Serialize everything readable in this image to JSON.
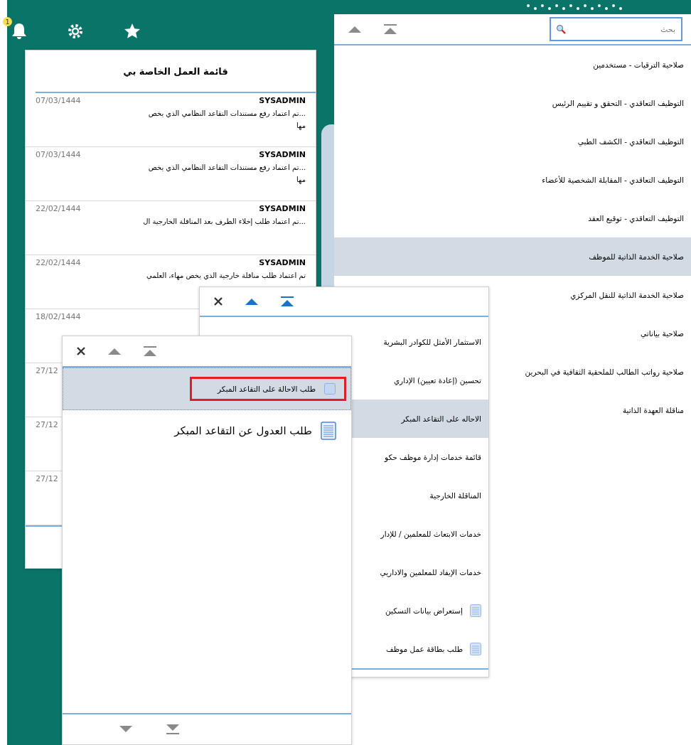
{
  "toolbar": {
    "notification_count": "1"
  },
  "worklist": {
    "title": "قائمة العمل الخاصة بي",
    "items": [
      {
        "sender": "SYSADMIN",
        "date": "07/03/1444",
        "message": "...تم اعتماد رفع مستندات التقاعد النظامي الذي يخص مها"
      },
      {
        "sender": "SYSADMIN",
        "date": "07/03/1444",
        "message": "...تم اعتماد رفع مستندات التقاعد النظامي الذي يخص مها"
      },
      {
        "sender": "SYSADMIN",
        "date": "22/02/1444",
        "message": "...تم اعتماد طلب إخلاء الطرف بعد المناقلة الخارجية ال"
      },
      {
        "sender": "SYSADMIN",
        "date": "22/02/1444",
        "message": "تم اعتماد طلب مناقلة خارجية الذي يخص مهاء، العلمي"
      },
      {
        "date": "18/02/1444"
      },
      {
        "date": "27/12"
      },
      {
        "date": "27/12"
      },
      {
        "date": "27/12"
      }
    ]
  },
  "main_menu": {
    "controls": [
      {
        "kind": "up",
        "disabled": true
      },
      {
        "kind": "top",
        "disabled": true
      }
    ],
    "search": {
      "placeholder": "بحث"
    },
    "items": [
      {
        "label": "صلاحية الترقيات - مستخدمين",
        "selected": false
      },
      {
        "label": "التوظيف التعاقدي - التحقق و تقييم الرئيس",
        "selected": false
      },
      {
        "label": "التوظيف التعاقدي - الكشف الطبي",
        "selected": false
      },
      {
        "label": "التوظيف التعاقدي - المقابلة الشخصية للأعضاء",
        "selected": false
      },
      {
        "label": "التوظيف التعاقدي - توقيع العقد",
        "selected": false
      },
      {
        "label": "صلاحية الخدمة الذاتية للموظف",
        "selected": true
      },
      {
        "label": "صلاحية الخدمة الذاتية للنقل المركزي",
        "selected": false
      },
      {
        "label": "صلاحية بياناتي",
        "selected": false
      },
      {
        "label": "صلاحية رواتب الطالب للملحقية الثقافية في البحرين",
        "selected": false
      },
      {
        "label": "مناقلة العهدة الذاتية",
        "selected": false
      }
    ]
  },
  "submenu": {
    "controls": [
      {
        "kind": "close"
      },
      {
        "kind": "up",
        "disabled": false
      },
      {
        "kind": "top",
        "disabled": false
      }
    ],
    "items": [
      {
        "label": "الاستثمار الأمثل للكوادر البشرية",
        "selected": false,
        "kind": "folder"
      },
      {
        "label": "تحسين (إعادة تعيين) الإداري",
        "selected": false,
        "kind": "folder"
      },
      {
        "label": "الاحاله على التقاعد المبكر",
        "selected": true,
        "kind": "folder"
      },
      {
        "label": "قائمة خدمات إدارة موظف حكو",
        "selected": false,
        "kind": "folder"
      },
      {
        "label": "المناقلة الخارجية",
        "selected": false,
        "kind": "folder"
      },
      {
        "label": "خدمات الابتعاث للمعلمين / للإدار",
        "selected": false,
        "kind": "folder"
      },
      {
        "label": "خدمات الإيفاد للمعلمين والاداريي",
        "selected": false,
        "kind": "folder"
      },
      {
        "label": "إستعراض بيانات التسكين",
        "selected": false,
        "kind": "document"
      },
      {
        "label": "طلب بطاقة عمل موظف",
        "selected": false,
        "kind": "document"
      }
    ]
  },
  "task_menu": {
    "controls": [
      {
        "kind": "close"
      },
      {
        "kind": "up",
        "disabled": true
      },
      {
        "kind": "top",
        "disabled": true
      }
    ],
    "footer_controls": [
      {
        "kind": "down",
        "disabled": true
      },
      {
        "kind": "bottom",
        "disabled": true
      }
    ],
    "items": [
      {
        "label": "طلب الاحالة على التقاعد المبكر",
        "selected": true,
        "outlined": true,
        "kind": "document"
      },
      {
        "label": "طلب العدول عن التقاعد المبكر",
        "selected": false,
        "outlined": false,
        "kind": "document-large"
      }
    ]
  }
}
